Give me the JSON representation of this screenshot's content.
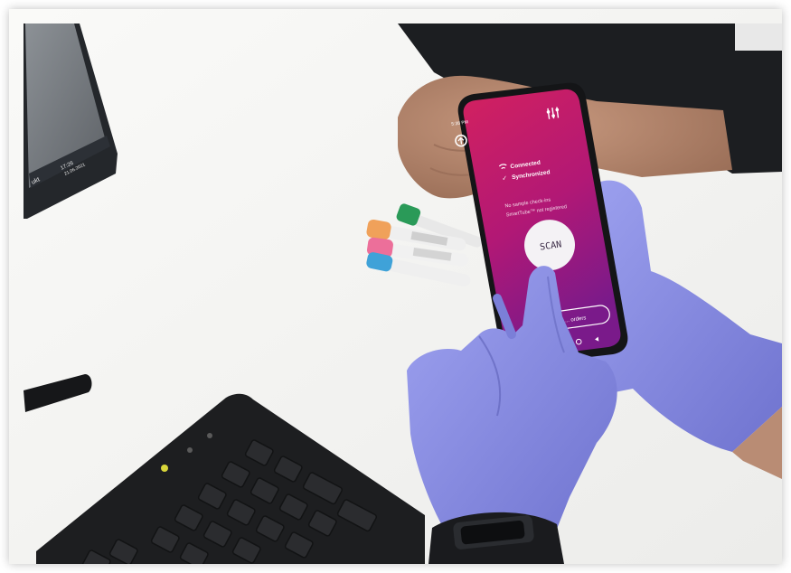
{
  "photo": {
    "monitor": {
      "taskbar_tray": "ukt",
      "clock_time": "17:26",
      "clock_date": "21.06.2021",
      "tray_icons": [
        "chevron-up-icon",
        "network-icon",
        "speaker-icon",
        "notification-icon"
      ]
    },
    "phone": {
      "status_time": "5:38 PM",
      "status_bar_icons": [
        "signal-icon",
        "wifi-icon",
        "battery-icon"
      ],
      "header_icons": [
        "app-logo-icon",
        "settings-sliders-icon"
      ],
      "connected_label": "Connected",
      "synchronized_label": "Synchronized",
      "message_line1": "No sample check-ins",
      "message_line2": "SmartTube™ not registered",
      "scan_label": "SCAN",
      "bottom_button_label": "... orders",
      "nav_icons": [
        "nav-square-icon",
        "nav-circle-icon",
        "nav-back-icon"
      ],
      "screen_gradient": [
        "#d3215f",
        "#a21680",
        "#6e1a8c"
      ]
    },
    "colors": {
      "glove": "#8b8fe6",
      "glove_shadow": "#6c70c8",
      "desk": "#f3f3f1",
      "keyboard": "#1d1e20",
      "keyboard_led": "#d8d63a",
      "sleeve": "#1c1e21",
      "skin": "#b98c74"
    },
    "tubes": [
      "green-cap-tube",
      "orange-cap-tube",
      "pink-cap-tube",
      "blue-cap-tube"
    ]
  }
}
